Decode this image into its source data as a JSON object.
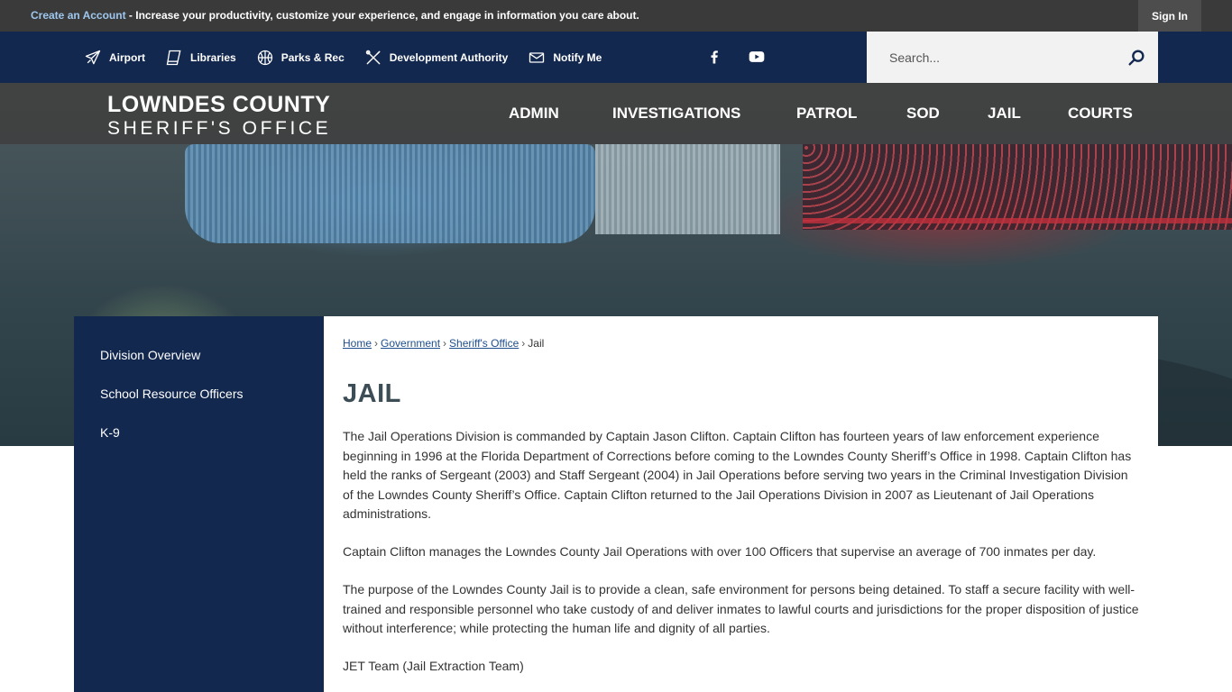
{
  "topbar": {
    "create_account": "Create an Account",
    "promo_text": " - Increase your productivity, customize your experience, and engage in information you care about.",
    "sign_in": "Sign In"
  },
  "utility": {
    "quicklinks": [
      {
        "label": "Airport",
        "icon": "airplane-icon"
      },
      {
        "label": "Libraries",
        "icon": "book-icon"
      },
      {
        "label": "Parks & Rec",
        "icon": "ball-icon"
      },
      {
        "label": "Development Authority",
        "icon": "tools-icon"
      },
      {
        "label": "Notify Me",
        "icon": "envelope-icon"
      }
    ],
    "social": [
      "facebook-icon",
      "youtube-icon"
    ]
  },
  "search": {
    "placeholder": "Search..."
  },
  "logo": {
    "line1": "LOWNDES COUNTY",
    "line2": "SHERIFF'S OFFICE"
  },
  "mainnav": [
    "ADMIN",
    "INVESTIGATIONS",
    "PATROL",
    "SOD",
    "JAIL",
    "COURTS"
  ],
  "sidebar": {
    "items": [
      "Division Overview",
      "School Resource Officers",
      "K-9"
    ]
  },
  "breadcrumb": {
    "home": "Home",
    "government": "Government",
    "sheriffs_office": "Sheriff's Office",
    "current": "Jail",
    "sep": "›"
  },
  "page": {
    "title": "JAIL",
    "paragraphs": [
      "The Jail Operations Division is commanded by Captain Jason Clifton. Captain Clifton has fourteen years of law enforcement experience beginning in 1996 at the Florida Department of Corrections before coming to the Lowndes County Sheriff’s Office in 1998. Captain Clifton has held the ranks of Sergeant (2003) and Staff Sergeant (2004) in Jail Operations before serving two years in the Criminal Investigation Division of the Lowndes County Sheriff’s Office. Captain Clifton returned to the Jail Operations Division in 2007 as Lieutenant of Jail Operations administrations.",
      "Captain Clifton manages the Lowndes County Jail Operations with over 100 Officers that supervise an average of 700 inmates per day.",
      "The purpose of the Lowndes County Jail is to provide a clean, safe environment for persons being detained. To staff a secure facility with well-trained and responsible personnel who take custody of and deliver inmates to lawful courts and jurisdictions for the proper disposition of justice without interference; while protecting the human life and dignity of all parties.",
      "JET Team (Jail Extraction Team)"
    ]
  },
  "colors": {
    "navy": "#13284f",
    "dark_gray": "#3a3a3a",
    "link": "#1e4e8c",
    "title": "#3d4d55"
  }
}
